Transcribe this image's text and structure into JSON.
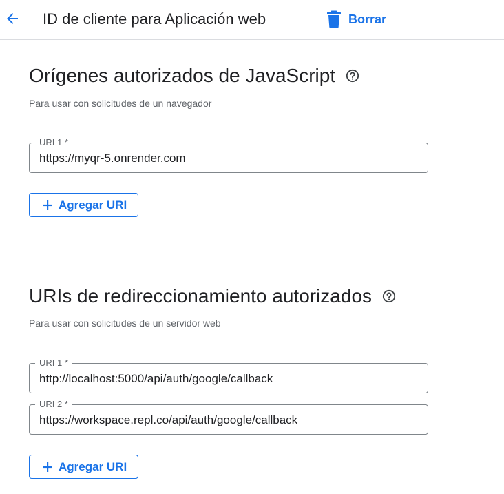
{
  "header": {
    "title": "ID de cliente para Aplicación web",
    "delete_label": "Borrar",
    "back_icon": "arrow-back-icon",
    "delete_icon": "trash-icon"
  },
  "colors": {
    "accent": "#1a73e8",
    "text": "#202124",
    "secondary_text": "#5f6368",
    "border": "#80868b"
  },
  "js_origins": {
    "title": "Orígenes autorizados de JavaScript",
    "subtitle": "Para usar con solicitudes de un navegador",
    "uris": [
      {
        "label": "URI 1 *",
        "value": "https://myqr-5.onrender.com"
      }
    ],
    "add_label": "Agregar URI"
  },
  "redirect_uris": {
    "title": "URIs de redireccionamiento autorizados",
    "subtitle": "Para usar con solicitudes de un servidor web",
    "uris": [
      {
        "label": "URI 1 *",
        "value": "http://localhost:5000/api/auth/google/callback"
      },
      {
        "label": "URI 2 *",
        "value": "https://workspace.repl.co/api/auth/google/callback"
      }
    ],
    "add_label": "Agregar URI"
  }
}
